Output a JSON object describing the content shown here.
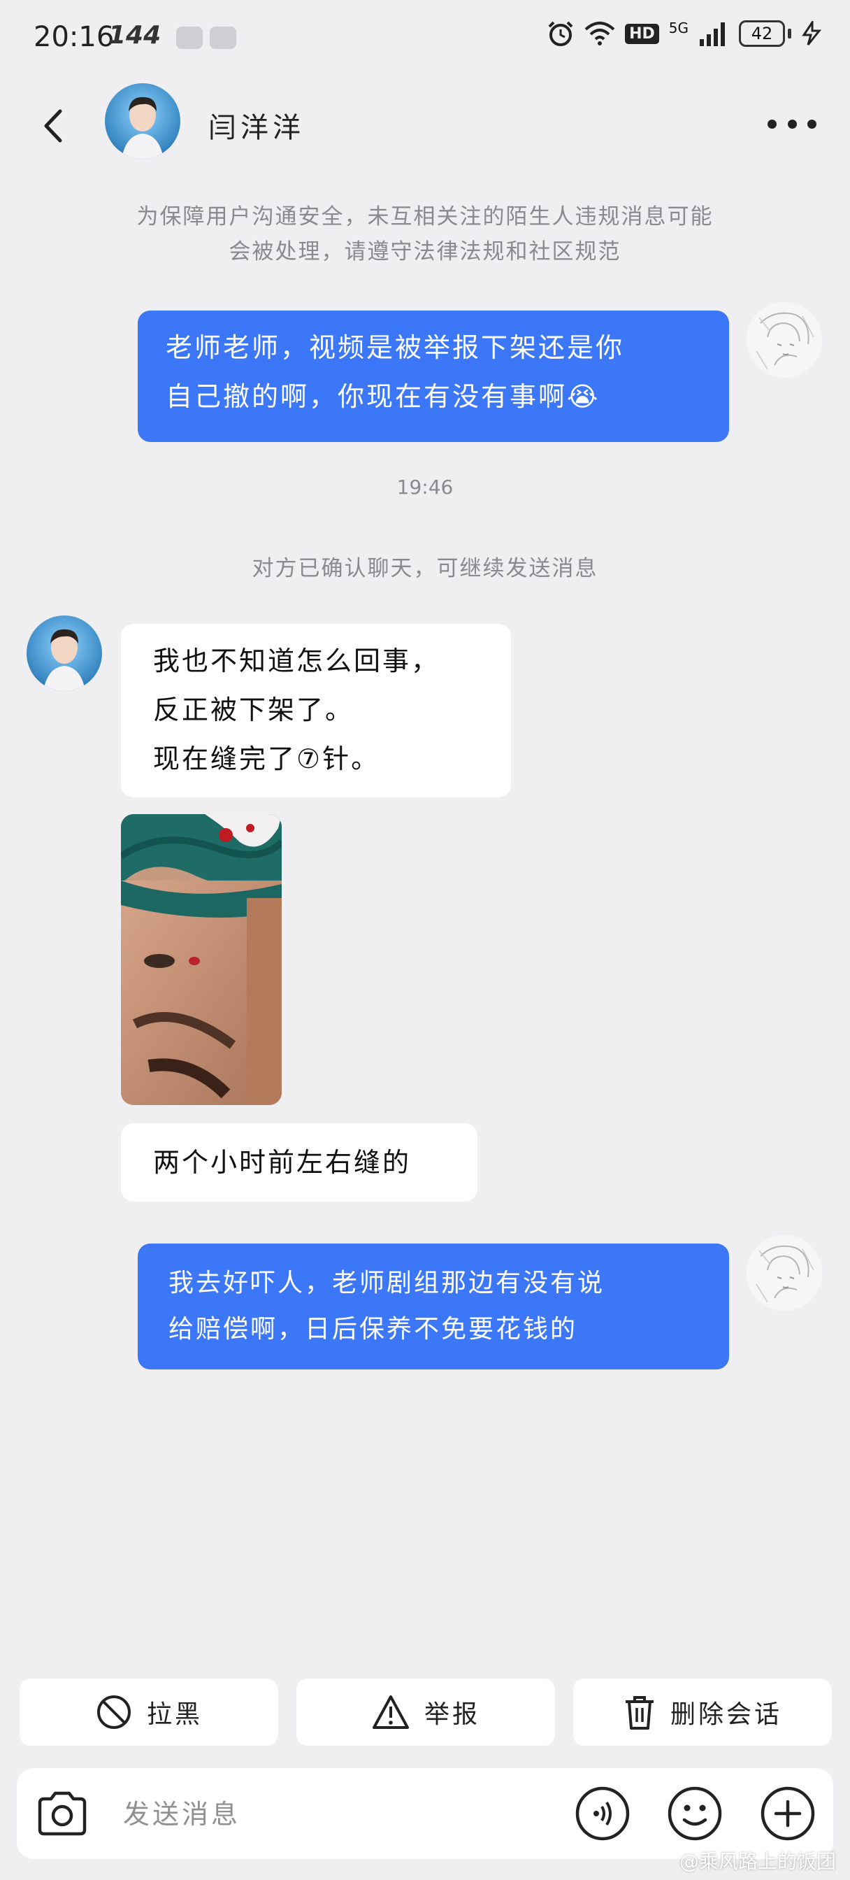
{
  "status_bar": {
    "time": "20:16",
    "refresh_rate": "144",
    "network": "HD",
    "signal_label": "5G",
    "battery": "42"
  },
  "header": {
    "contact_name": "闫洋洋",
    "back_icon": "chevron-left-icon",
    "more_icon": "more-dots-icon"
  },
  "notice": {
    "lines": [
      "为保障用户沟通安全，未互相关注的陌生人违规消息可能",
      "会被处理，请遵守法律法规和社区规范"
    ]
  },
  "messages": [
    {
      "direction": "outgoing",
      "lines": [
        "老师老师，视频是被举报下架还是你",
        "自己撤的啊，你现在有没有事啊😭"
      ]
    },
    {
      "type": "timestamp",
      "text": "19:46"
    },
    {
      "type": "system",
      "text": "对方已确认聊天，可继续发送消息"
    },
    {
      "direction": "incoming",
      "lines": [
        "我也不知道怎么回事，",
        "反正被下架了。",
        "现在缝完了⑦针。"
      ]
    },
    {
      "direction": "incoming",
      "type": "image"
    },
    {
      "direction": "incoming",
      "lines": [
        "两个小时前左右缝的"
      ]
    },
    {
      "direction": "outgoing",
      "lines": [
        "我去好吓人，老师剧组那边有没有说",
        "给赔偿啊，日后保养不免要花钱的"
      ]
    }
  ],
  "actions": {
    "block_label": "拉黑",
    "report_label": "举报",
    "delete_label": "删除会话"
  },
  "input": {
    "placeholder": "发送消息"
  },
  "watermark": "@乘风路上的饭团",
  "colors": {
    "background": "#efeff1",
    "outgoing_bubble": "#3b77f6",
    "incoming_bubble": "#ffffff",
    "muted_text": "#8a8a8e"
  }
}
